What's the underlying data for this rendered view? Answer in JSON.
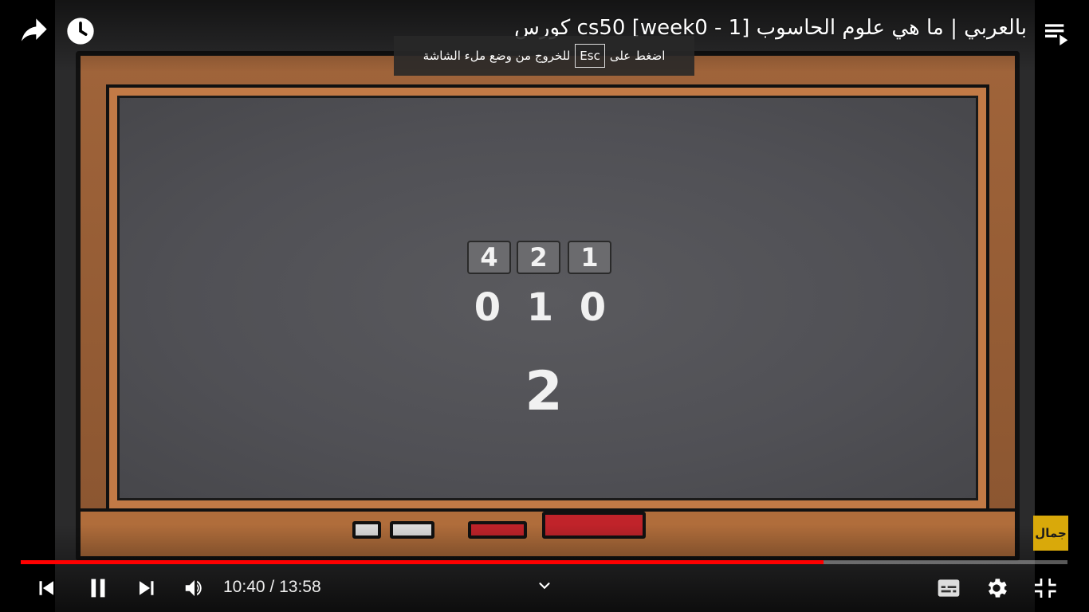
{
  "window": {
    "title": "كورس cs50 [week0 - 1] بالعربي | ما هي علوم الحاسوب"
  },
  "toast": {
    "before": "اضغط على",
    "key": "Esc",
    "after": "للخروج من وضع ملء الشاشة"
  },
  "video_frame": {
    "place_values": [
      "4",
      "2",
      "1"
    ],
    "bits": [
      "0",
      "1",
      "0"
    ],
    "result": "2"
  },
  "watermark": {
    "text": "جمال"
  },
  "player": {
    "current_time": "10:40",
    "separator": "/",
    "duration": "13:58",
    "progress_fraction": 0.767,
    "accent_color": "#ff0000"
  },
  "icons": {
    "share": "share-icon",
    "watch_later": "clock-icon",
    "playlist": "playlist-icon",
    "previous": "skip-previous-icon",
    "pause": "pause-icon",
    "next": "skip-next-icon",
    "volume": "volume-icon",
    "chevron": "chevron-down-icon",
    "subtitles": "subtitles-icon",
    "settings": "gear-icon",
    "exit_fullscreen": "exit-fullscreen-icon"
  }
}
